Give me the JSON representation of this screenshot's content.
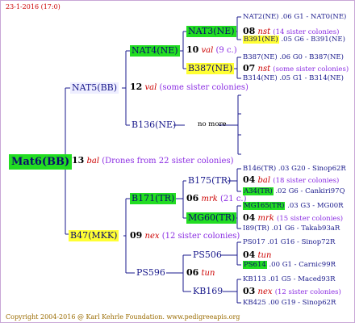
{
  "header": {
    "date": "23-1-2016 (17:0)"
  },
  "footer": {
    "copyright": "Copyright 2004-2016 @ Karl Kehrle Foundation.",
    "site": "www.pedigreeapis.org"
  },
  "colors": {
    "green": "#22dd22",
    "yellow": "#ffff33",
    "lavender": "#eeeeff",
    "line": "#1a1a8c",
    "relation": "#cc0000",
    "sisters": "#8a2be2"
  },
  "root": {
    "name": "Mat6(BB)"
  },
  "gen1": {
    "num": "13",
    "rel": "bal",
    "sis": "(Drones from 22 sister colonies)"
  },
  "nat5": {
    "name": "NAT5(BB)",
    "num": "12",
    "rel": "val",
    "sis": "(some sister colonies)"
  },
  "nat4": {
    "name": "NAT4(NE)",
    "num": "10",
    "rel": "val",
    "sis": "(9 c.)"
  },
  "nat3": {
    "name": "NAT3(NE)",
    "num": "08",
    "rel": "nst",
    "sis": "(14 sister colonies)"
  },
  "b387": {
    "name": "B387(NE)",
    "num": "07",
    "rel": "nst",
    "sis": "(some sister colonies)"
  },
  "b136": {
    "name": "B136(NE)",
    "more": "no more"
  },
  "b47": {
    "name": "B47(MKK)",
    "num": "09",
    "rel": "nex",
    "sis": "(12 sister colonies)"
  },
  "b171": {
    "name": "B171(TR)",
    "num": "06",
    "rel": "mrk",
    "sis": "(21 c.)"
  },
  "b175": {
    "name": "B175(TR)",
    "num": "04",
    "rel": "bal",
    "sis": "(18 sister colonies)"
  },
  "mg60": {
    "name": "MG60(TR)",
    "num": "04",
    "rel": "mrk",
    "sis": "(15 sister colonies)"
  },
  "ps596": {
    "name": "PS596",
    "num": "06",
    "rel": "tun"
  },
  "ps506": {
    "name": "PS506",
    "num": "04",
    "rel": "tun"
  },
  "kb169": {
    "name": "KB169",
    "num": "03",
    "rel": "nex",
    "sis": "(12 sister colonies)"
  },
  "leaves": [
    {
      "name": "NAT2(NE)",
      "mid": ".06",
      "code": "G1",
      "right": "- NAT0(NE)"
    },
    {
      "name": "B391(NE)",
      "mid": ".05",
      "code": "G6",
      "right": "- B391(NE)"
    },
    {
      "name": "B387(NE)",
      "mid": ".06",
      "code": "G0",
      "right": "- B387(NE)"
    },
    {
      "name": "B314(NE)",
      "mid": ".05",
      "code": "G1",
      "right": "- B314(NE)"
    },
    {
      "name": "B146(TR)",
      "mid": ".03",
      "code": "G20",
      "right": "- Sinop62R"
    },
    {
      "name": "A34(TR)",
      "mid": ".02",
      "code": "G6",
      "right": "- Cankiri97Q"
    },
    {
      "name": "MG165(TR)",
      "mid": ".03",
      "code": "G3",
      "right": "- MG00R"
    },
    {
      "name": "I89(TR)",
      "mid": ".01",
      "code": "G6",
      "right": "- Takab93aR"
    },
    {
      "name": "PS017",
      "mid": ".01",
      "code": "G16",
      "right": "- Sinop72R"
    },
    {
      "name": "PS614",
      "mid": ".00",
      "code": "G1",
      "right": "- Carnic99R"
    },
    {
      "name": "KB113",
      "mid": ".01",
      "code": "G5",
      "right": "- Maced93R"
    },
    {
      "name": "KB425",
      "mid": ".00",
      "code": "G19",
      "right": "- Sinop62R"
    }
  ]
}
